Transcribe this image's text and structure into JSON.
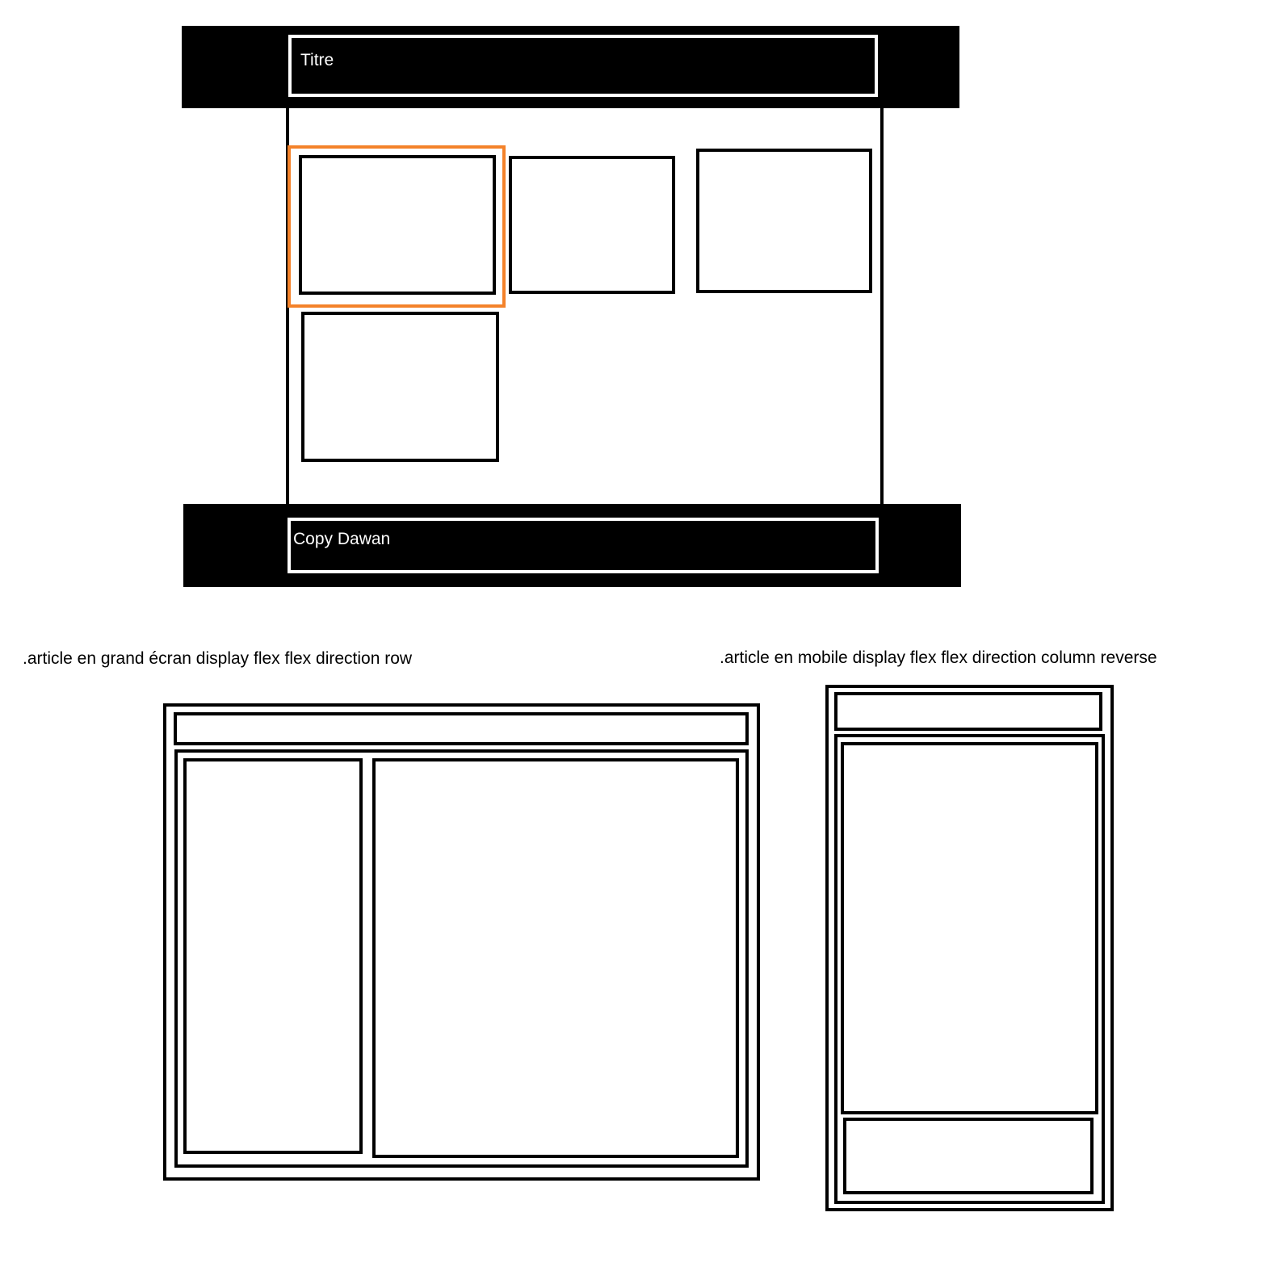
{
  "header": {
    "title": "Titre"
  },
  "footer": {
    "text": "Copy Dawan"
  },
  "captions": {
    "desktop": ".article en grand écran display flex flex direction row",
    "mobile": ".article en mobile display flex flex direction column reverse"
  },
  "colors": {
    "bars": "#000000",
    "highlight": "#f4822a",
    "lines": "#000000",
    "background": "#ffffff"
  }
}
